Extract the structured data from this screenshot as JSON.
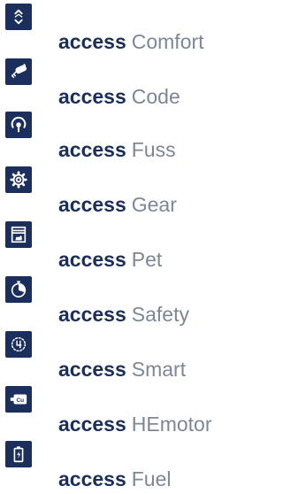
{
  "colors": {
    "brand": "#1b2f5c",
    "product_name": "#7d8799",
    "icon_background": "#1b2f5c",
    "icon_foreground": "#ffffff"
  },
  "products": [
    {
      "brand": "access",
      "name": "Comfort",
      "icon": "up-down-arrows-icon"
    },
    {
      "brand": "access",
      "name": "Code",
      "icon": "key-remote-icon"
    },
    {
      "brand": "access",
      "name": "Fuss",
      "icon": "foot-sensor-icon"
    },
    {
      "brand": "access",
      "name": "Gear",
      "icon": "gear-icon"
    },
    {
      "brand": "access",
      "name": "Pet",
      "icon": "pet-door-icon"
    },
    {
      "brand": "access",
      "name": "Safety",
      "icon": "stopwatch-icon"
    },
    {
      "brand": "access",
      "name": "Smart",
      "icon": "smart-timer-icon"
    },
    {
      "brand": "access",
      "name": "HEmotor",
      "icon": "copper-motor-icon"
    },
    {
      "brand": "access",
      "name": "Fuel",
      "icon": "battery-bolt-icon"
    }
  ]
}
